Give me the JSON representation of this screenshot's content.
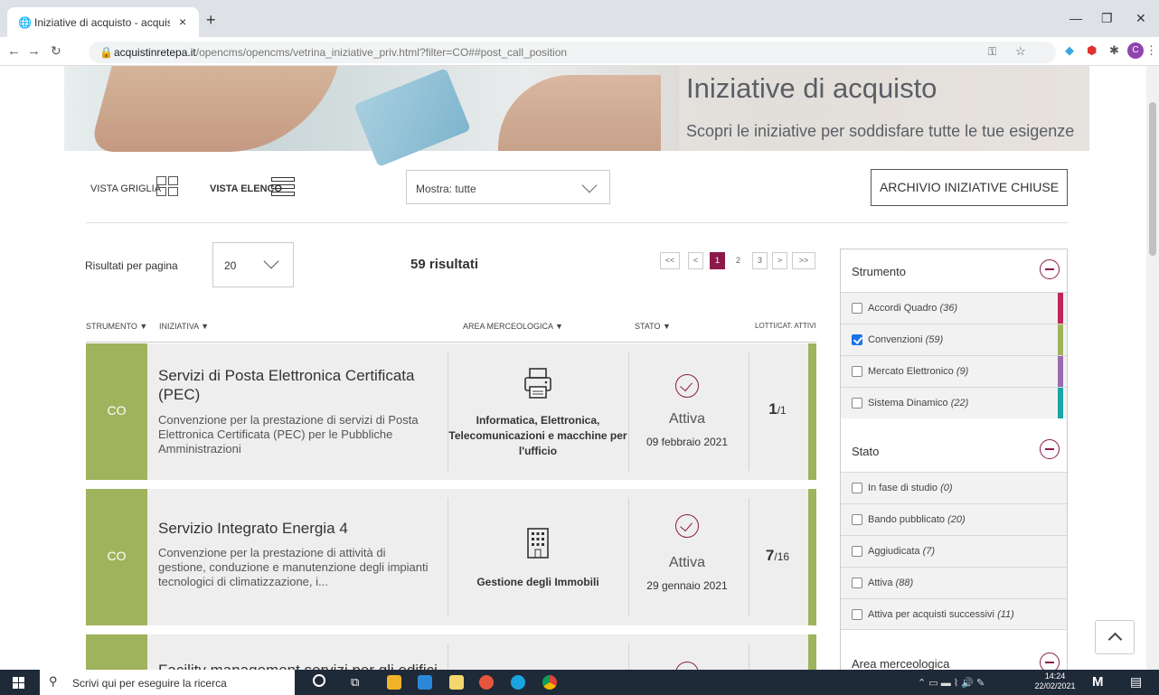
{
  "browser": {
    "tab_title": "Iniziative di acquisto - acquistinre",
    "new_tab": "+",
    "close_tab": "×",
    "url_host": "acquistinretepa.it",
    "url_path": "/opencms/opencms/vetrina_iniziative_priv.html?filter=CO##post_call_position",
    "profile_initial": "C"
  },
  "hero": {
    "title": "Iniziative di acquisto",
    "subtitle": "Scopri le iniziative per soddisfare tutte le tue esigenze"
  },
  "toolbar": {
    "vista_griglia": "VISTA GRIGLIA",
    "vista_elenco": "VISTA ELENCO",
    "mostra_value": "Mostra: tutte",
    "archivio": "ARCHIVIO INIZIATIVE CHIUSE"
  },
  "results_bar": {
    "per_page_label": "Risultati per pagina",
    "per_page_value": "20",
    "count": "59 risultati",
    "pagination": [
      "<<",
      "<",
      "1",
      "2",
      "3",
      ">",
      ">>"
    ],
    "current_page": "1"
  },
  "columns": {
    "strumento": "STRUMENTO ▼",
    "iniziativa": "INIZIATIVA ▼",
    "area": "AREA MERCEOLOGICA ▼",
    "stato": "STATO ▼",
    "lotti": "LOTTI/CAT. ATTIVI"
  },
  "rows": [
    {
      "code": "CO",
      "title": "Servizi di Posta Elettronica Certificata (PEC)",
      "description": "Convenzione per la prestazione di servizi di Posta Elettronica Certificata (PEC) per le Pubbliche Amministrazioni",
      "area": "Informatica, Elettronica, Telecomunicazioni e macchine per l'ufficio",
      "area_icon": "printer-icon",
      "stato": "Attiva",
      "data": "09 febbraio 2021",
      "lotti_active": "1",
      "lotti_total": "/1"
    },
    {
      "code": "CO",
      "title": "Servizio Integrato Energia 4",
      "description": "Convenzione per la prestazione di attività di gestione, conduzione e manutenzione degli impianti tecnologici di climatizzazione, i...",
      "area": "Gestione degli Immobili",
      "area_icon": "building-icon",
      "stato": "Attiva",
      "data": "29 gennaio 2021",
      "lotti_active": "7",
      "lotti_total": "/16"
    },
    {
      "code": "CO",
      "title": "Facility management servizi per gli edifici",
      "description": "",
      "area": "",
      "area_icon": "",
      "stato": "",
      "data": "",
      "lotti_active": "",
      "lotti_total": ""
    }
  ],
  "filters": {
    "strumento": {
      "title": "Strumento",
      "items": [
        {
          "label": "Accordi Quadro",
          "count": "(36)",
          "checked": false,
          "color": "#c2255c"
        },
        {
          "label": "Convenzioni",
          "count": "(59)",
          "checked": true,
          "color": "#9fb35c"
        },
        {
          "label": "Mercato Elettronico",
          "count": "(9)",
          "checked": false,
          "color": "#9b6bb0"
        },
        {
          "label": "Sistema Dinamico",
          "count": "(22)",
          "checked": false,
          "color": "#1ba5a5"
        }
      ]
    },
    "stato": {
      "title": "Stato",
      "items": [
        {
          "label": "In fase di studio",
          "count": "(0)"
        },
        {
          "label": "Bando pubblicato",
          "count": "(20)"
        },
        {
          "label": "Aggiudicata",
          "count": "(7)"
        },
        {
          "label": "Attiva",
          "count": "(88)"
        },
        {
          "label": "Attiva per acquisti successivi",
          "count": "(11)"
        }
      ]
    },
    "area": {
      "title": "Area merceologica"
    }
  },
  "taskbar": {
    "search_placeholder": "Scrivi qui per eseguire la ricerca",
    "time": "14:24",
    "date": "22/02/2021"
  },
  "colors": {
    "accent": "#8b1a4a",
    "convenzioni": "#9fb35c"
  }
}
